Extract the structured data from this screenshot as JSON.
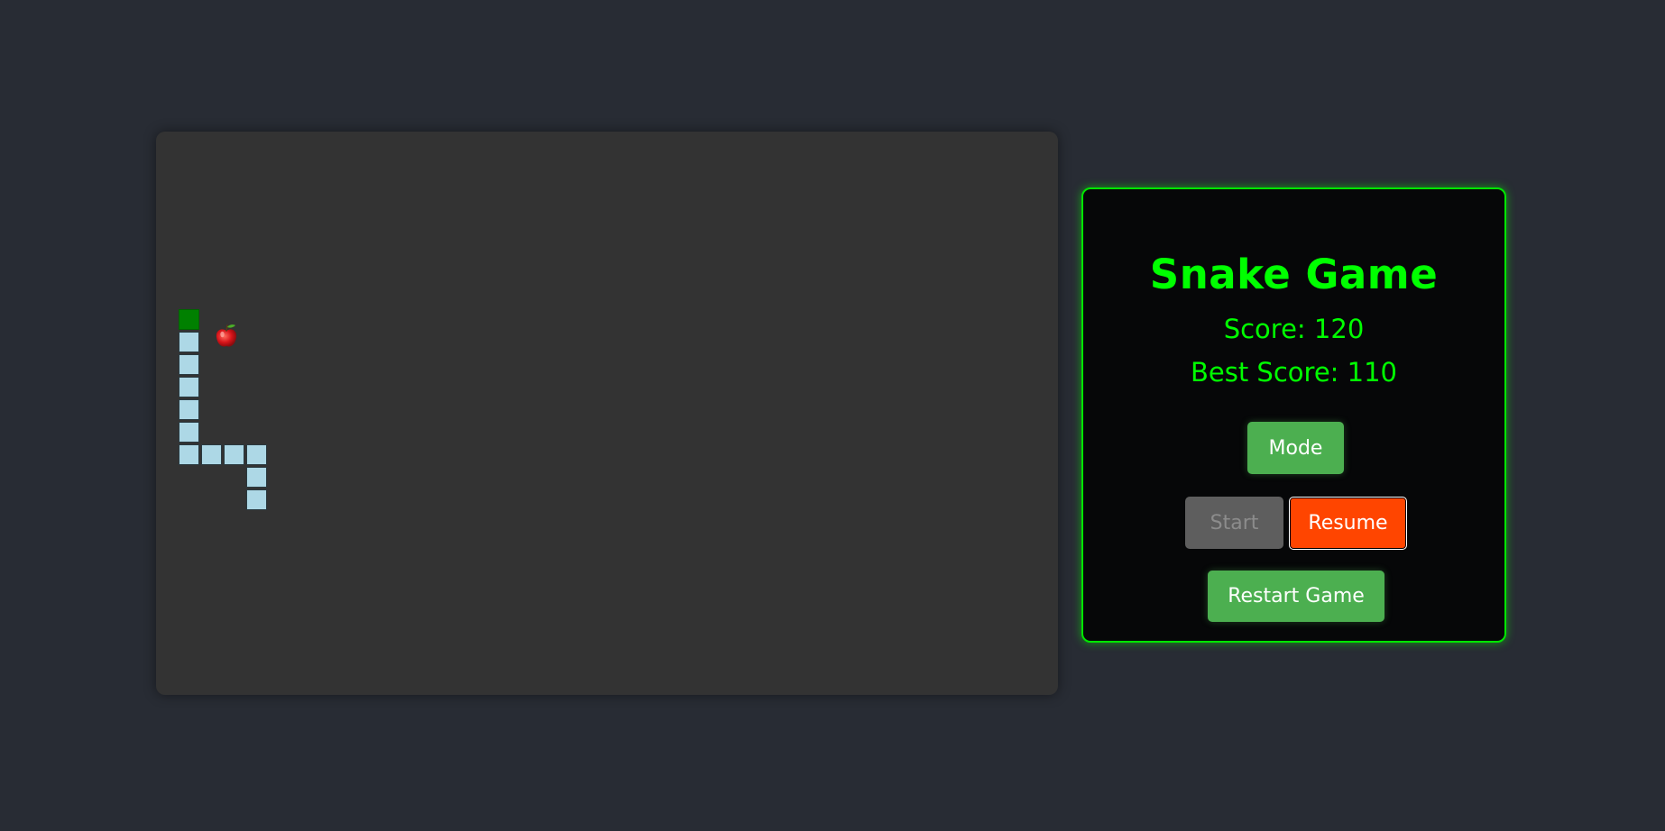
{
  "game": {
    "board_color": "#333333",
    "snake_head_color": "#008000",
    "snake_body_color": "#add8e6",
    "food_icon": "apple-icon",
    "grid": {
      "cols": 40,
      "rows": 25
    },
    "snake": [
      {
        "col": 1,
        "row": 8,
        "type": "head"
      },
      {
        "col": 1,
        "row": 9,
        "type": "body"
      },
      {
        "col": 1,
        "row": 10,
        "type": "body"
      },
      {
        "col": 1,
        "row": 11,
        "type": "body"
      },
      {
        "col": 1,
        "row": 12,
        "type": "body"
      },
      {
        "col": 1,
        "row": 13,
        "type": "body"
      },
      {
        "col": 1,
        "row": 14,
        "type": "body"
      },
      {
        "col": 2,
        "row": 14,
        "type": "body"
      },
      {
        "col": 3,
        "row": 14,
        "type": "body"
      },
      {
        "col": 4,
        "row": 14,
        "type": "body"
      },
      {
        "col": 4,
        "row": 15,
        "type": "body"
      },
      {
        "col": 4,
        "row": 16,
        "type": "body"
      }
    ],
    "food": {
      "col": 3,
      "row": 10
    }
  },
  "panel": {
    "title": "Snake Game",
    "score": "Score: 120",
    "best_score": "Best Score: 110",
    "accent_color": "#00ff00",
    "buttons": {
      "mode": "Mode",
      "start": "Start",
      "resume": "Resume",
      "restart": "Restart Game"
    }
  }
}
